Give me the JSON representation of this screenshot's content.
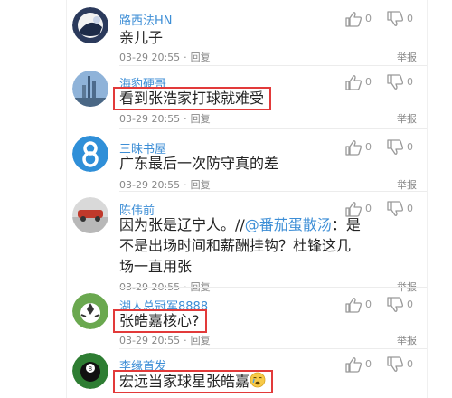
{
  "comments": [
    {
      "user": "路西法HN",
      "text": "亲儿子",
      "time": "03-29 20:55",
      "reply": "回复",
      "report": "举报",
      "likes": "0",
      "dislikes": "0"
    },
    {
      "user": "海豹硬哥",
      "text": "看到张浩家打球就难受",
      "time": "03-29 20:55",
      "reply": "回复",
      "report": "举报",
      "likes": "0",
      "dislikes": "0"
    },
    {
      "user": "三昧书屋",
      "text": "广东最后一次防守真的差",
      "time": "03-29 20:55",
      "reply": "回复",
      "report": "举报",
      "likes": "0",
      "dislikes": "0"
    },
    {
      "user": "陈伟前",
      "text_prefix": "因为张是辽宁人。//",
      "mention": "@番茄蛋散汤",
      "text_l1_rest": "：是",
      "text_l2": "不是出场时间和薪酬挂钩？杜锋这几",
      "text_l3": "场一直用张",
      "time": "03-29 20:55",
      "reply": "回复",
      "report": "举报",
      "likes": "0",
      "dislikes": "0"
    },
    {
      "user": "湖人总冠军8888",
      "text": "张皓嘉核心?",
      "time": "03-29 20:55",
      "reply": "回复",
      "report": "举报",
      "likes": "0",
      "dislikes": "0"
    },
    {
      "user": "李缘首发",
      "text": "宏远当家球星张皓嘉",
      "likes": "0",
      "dislikes": "0"
    }
  ]
}
